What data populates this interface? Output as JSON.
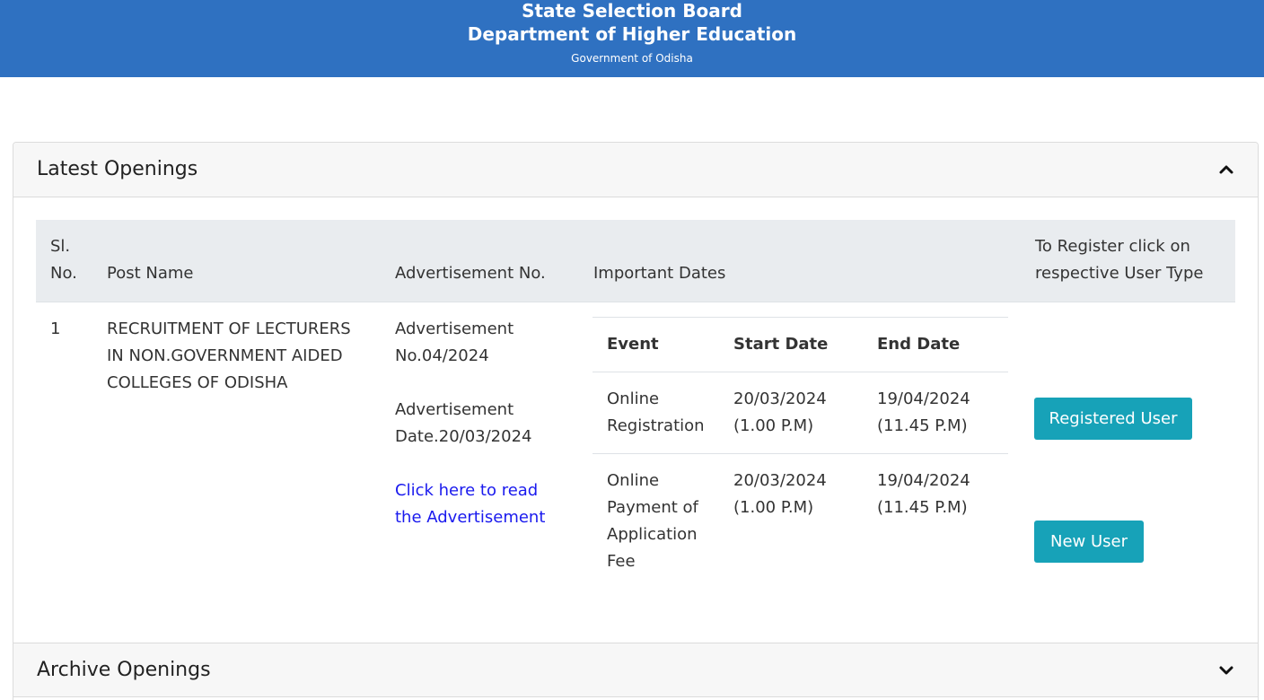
{
  "header": {
    "line1": "State Selection Board",
    "line2": "Department of Higher Education",
    "line3": "Government of Odisha",
    "bg_color": "#2f71c1"
  },
  "latest": {
    "title": "Latest Openings",
    "icon": "chevron-up-icon",
    "table": {
      "headers": {
        "sl_line1": "Sl.",
        "sl_line2": "No.",
        "post_name": "Post Name",
        "adv_no": "Advertisement No.",
        "dates": "Important Dates",
        "register_line1": "To Register click on",
        "register_line2": "respective User Type"
      },
      "rows": [
        {
          "sl": "1",
          "post_line1": "RECRUITMENT OF LECTURERS",
          "post_line2": "IN NON.GOVERNMENT AIDED",
          "post_line3": "COLLEGES OF ODISHA",
          "adv_no_line1": "Advertisement",
          "adv_no_line2": "No.04/2024",
          "adv_date_line1": "Advertisement",
          "adv_date_line2": "Date.20/03/2024",
          "link_line1": "Click here to read",
          "link_line2": "the Advertisement",
          "dates_table": {
            "headers": {
              "event": "Event",
              "start": "Start Date",
              "end": "End Date"
            },
            "rows": [
              {
                "event_line1": "Online",
                "event_line2": "Registration",
                "event_line3": "",
                "event_line4": "",
                "start_line1": "20/03/2024",
                "start_line2": "(1.00 P.M)",
                "end_line1": "19/04/2024",
                "end_line2": "(11.45 P.M)"
              },
              {
                "event_line1": "Online",
                "event_line2": "Payment of",
                "event_line3": "Application",
                "event_line4": "Fee",
                "start_line1": "20/03/2024",
                "start_line2": "(1.00 P.M)",
                "end_line1": "19/04/2024",
                "end_line2": "(11.45 P.M)"
              }
            ]
          },
          "buttons": {
            "registered": "Registered User",
            "new": "New User",
            "color": "#17a2b8"
          }
        }
      ]
    }
  },
  "archive": {
    "title": "Archive Openings",
    "icon": "chevron-down-icon"
  }
}
